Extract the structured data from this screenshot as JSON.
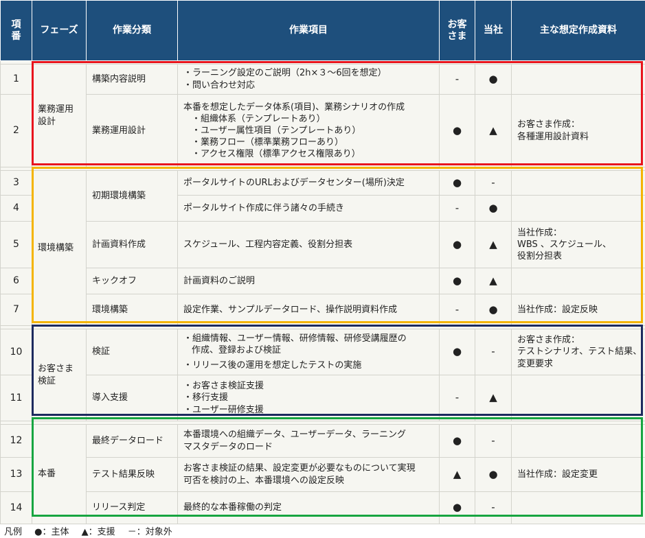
{
  "headers": {
    "no": [
      "項",
      "番"
    ],
    "phase": "フェーズ",
    "category": "作業分類",
    "items": "作業項目",
    "customer": [
      "お客",
      "さま"
    ],
    "company": "当社",
    "materials": "主な想定作成資料"
  },
  "marks": {
    "main": "●",
    "support": "▲",
    "none": "-"
  },
  "rows": [
    {
      "no": "1",
      "phase": [
        "業務運用",
        "設計"
      ],
      "category": "構築内容説明",
      "items": [
        "・ラーニング設定のご説明（2h×３～6回を想定）",
        "・問い合わせ対応"
      ],
      "customer": "-",
      "company": "●",
      "materials": []
    },
    {
      "no": "2",
      "category": "業務運用設計",
      "items": [
        "本番を想定したデータ体系(項目)、業務シナリオの作成",
        "・組織体系（テンプレートあり）",
        "・ユーザー属性項目（テンプレートあり）",
        "・業務フロー（標準業務フローあり）",
        "・アクセス権限（標準アクセス権限あり）"
      ],
      "customer": "●",
      "company": "▲",
      "materials": [
        "お客さま作成：",
        "各種運用設計資料"
      ]
    },
    {
      "no": "3",
      "phase": [
        "環境構築"
      ],
      "category": "初期環境構築",
      "items": [
        "ポータルサイトのURLおよびデータセンター(場所)決定"
      ],
      "customer": "●",
      "company": "-",
      "materials": []
    },
    {
      "no": "4",
      "items": [
        "ポータルサイト作成に伴う諸々の手続き"
      ],
      "customer": "-",
      "company": "●",
      "materials": []
    },
    {
      "no": "5",
      "category": "計画資料作成",
      "items": [
        "スケジュール、工程内容定義、役割分担表"
      ],
      "customer": "●",
      "company": "▲",
      "materials": [
        "当社作成：",
        "WBS 、スケジュール、",
        "役割分担表"
      ]
    },
    {
      "no": "6",
      "category": "キックオフ",
      "items": [
        "計画資料のご説明"
      ],
      "customer": "●",
      "company": "▲",
      "materials": []
    },
    {
      "no": "7",
      "category": "環境構築",
      "items": [
        "設定作業、サンプルデータロード、操作説明資料作成"
      ],
      "customer": "-",
      "company": "●",
      "materials": [
        "当社作成：設定反映"
      ]
    },
    {
      "no": "10",
      "phase": [
        "お客さま",
        "検証"
      ],
      "category": "検証",
      "items": [
        "・組織情報、ユーザー情報、研修情報、研修受講履歴の",
        "作成、登録および検証",
        "・リリース後の運用を想定したテストの実施"
      ],
      "customer": "●",
      "company": "-",
      "materials": [
        "お客さま作成：",
        "テストシナリオ、テスト結果、",
        "変更要求"
      ]
    },
    {
      "no": "11",
      "category": "導入支援",
      "items": [
        "・お客さま検証支援",
        "・移行支援",
        "・ユーザー研修支援"
      ],
      "customer": "-",
      "company": "▲",
      "materials": []
    },
    {
      "no": "12",
      "phase": [
        "本番"
      ],
      "category": "最終データロード",
      "items": [
        "本番環境への組織データ、ユーザーデータ、ラーニング",
        "マスタデータのロード"
      ],
      "customer": "●",
      "company": "-",
      "materials": []
    },
    {
      "no": "13",
      "category": "テスト結果反映",
      "items": [
        "お客さま検証の結果、設定変更が必要なものについて実現",
        "可否を検討の上、本番環境への設定反映"
      ],
      "customer": "▲",
      "company": "●",
      "materials": [
        "当社作成：設定変更"
      ]
    },
    {
      "no": "14",
      "category": "リリース判定",
      "items": [
        "最終的な本番稼働の判定"
      ],
      "customer": "●",
      "company": "-",
      "materials": []
    }
  ],
  "legend": {
    "title": "凡例",
    "main": "●：主体",
    "support": "▲：支援",
    "none": "－：対象外"
  },
  "colors": {
    "header": "#1e4f7c",
    "group_1": "#e8141d",
    "group_2": "#f4b400",
    "group_3": "#1c2a5e",
    "group_4": "#17a541"
  }
}
